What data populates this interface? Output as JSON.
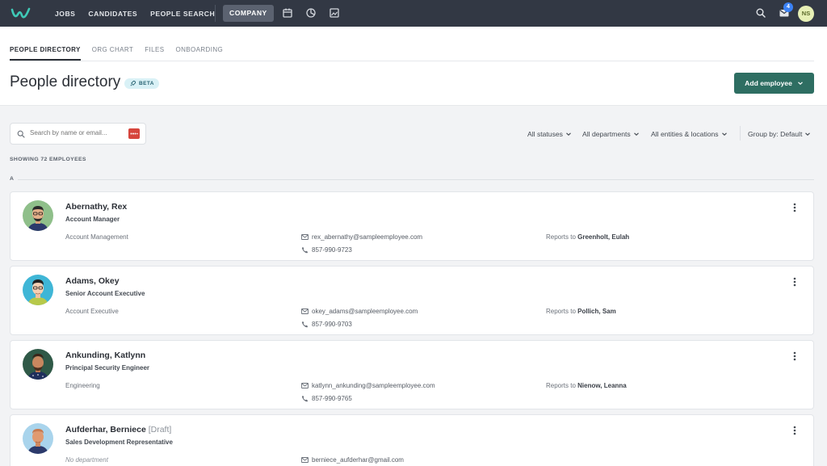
{
  "nav": {
    "items": [
      "JOBS",
      "CANDIDATES",
      "PEOPLE SEARCH"
    ],
    "active": "COMPANY",
    "notification_count": "4",
    "user_initials": "NS"
  },
  "tabs": [
    {
      "label": "PEOPLE DIRECTORY",
      "active": true
    },
    {
      "label": "ORG CHART",
      "active": false
    },
    {
      "label": "FILES",
      "active": false
    },
    {
      "label": "ONBOARDING",
      "active": false
    }
  ],
  "page": {
    "title": "People directory",
    "badge": "BETA",
    "add_button": "Add employee"
  },
  "search": {
    "placeholder": "Search by name or email..."
  },
  "filters": {
    "statuses": "All statuses",
    "departments": "All departments",
    "entities": "All entities & locations",
    "group_by": "Group by: Default"
  },
  "showing": "SHOWING 72 EMPLOYEES",
  "group_letter": "A",
  "reports_prefix": "Reports to",
  "employees": [
    {
      "name": "Abernathy, Rex",
      "draft": "",
      "title": "Account Manager",
      "department": "Account Management",
      "email": "rex_abernathy@sampleemployee.com",
      "phone": "857-990-9723",
      "reports_to": "Greenholt, Eulah"
    },
    {
      "name": "Adams, Okey",
      "draft": "",
      "title": "Senior Account Executive",
      "department": "Account Executive",
      "email": "okey_adams@sampleemployee.com",
      "phone": "857-990-9703",
      "reports_to": "Pollich, Sam"
    },
    {
      "name": "Ankunding, Katlynn",
      "draft": "",
      "title": "Principal Security Engineer",
      "department": "Engineering",
      "email": "katlynn_ankunding@sampleemployee.com",
      "phone": "857-990-9765",
      "reports_to": "Nienow, Leanna"
    },
    {
      "name": "Aufderhar, Berniece",
      "draft": "[Draft]",
      "title": "Sales Development Representative",
      "department": "No department",
      "email": "berniece_aufderhar@gmail.com",
      "phone": "",
      "reports_to": ""
    }
  ],
  "colors": {
    "topbar": "#323844",
    "primary_button": "#2e6e62",
    "beta_badge": "#d9f1f6",
    "notification_badge": "#3b82f6"
  }
}
